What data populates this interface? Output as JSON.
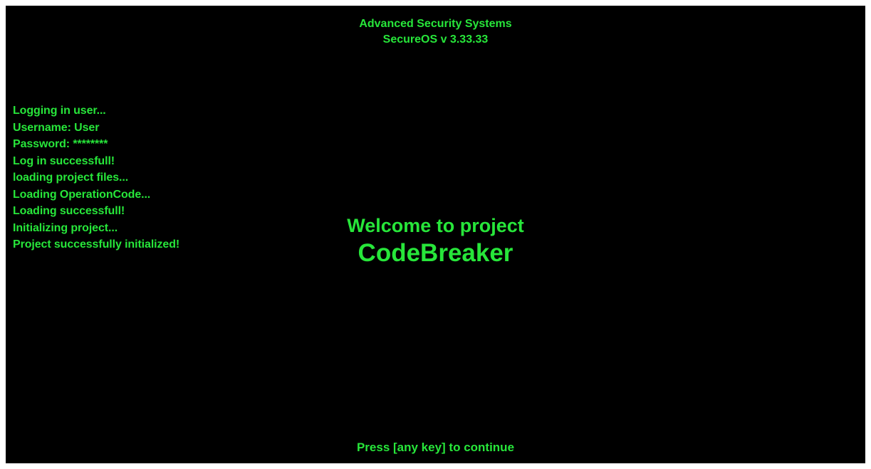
{
  "header": {
    "company": "Advanced Security Systems",
    "os_version": "SecureOS v 3.33.33"
  },
  "log": {
    "lines": [
      "Logging in user...",
      "Username: User",
      "Password: ********",
      "Log in successfull!",
      "loading project files...",
      "Loading OperationCode...",
      "Loading successfull!",
      "Initializing project...",
      "Project successfully initialized!"
    ]
  },
  "welcome": {
    "line1": "Welcome to project",
    "project_name": "CodeBreaker"
  },
  "prompt": {
    "text": "Press [any key] to continue"
  },
  "colors": {
    "background": "#000000",
    "text": "#27e63a",
    "frame": "#ffffff"
  }
}
